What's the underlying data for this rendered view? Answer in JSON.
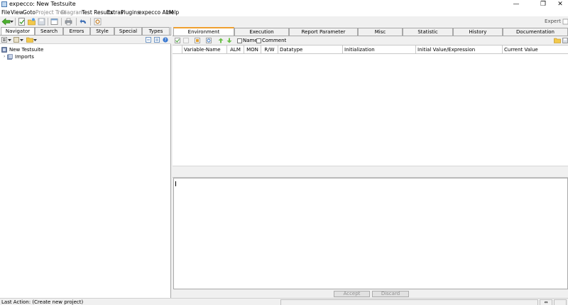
{
  "window": {
    "title": "expecco: New Testsuite",
    "minimize": "—",
    "restore": "❐",
    "close": "✕"
  },
  "menu": [
    {
      "label": "File",
      "enabled": true
    },
    {
      "label": "View",
      "enabled": true
    },
    {
      "label": "Goto",
      "enabled": true
    },
    {
      "label": "Project Tree",
      "enabled": false
    },
    {
      "label": "Diagram",
      "enabled": false
    },
    {
      "label": "Test Results",
      "enabled": true
    },
    {
      "label": "Extras",
      "enabled": true
    },
    {
      "label": "Plugins",
      "enabled": true
    },
    {
      "label": "expecco ALM",
      "enabled": true
    },
    {
      "label": "Help",
      "enabled": true
    }
  ],
  "toolbar": {
    "mode_label": "Expert"
  },
  "left": {
    "tabs": [
      "Navigator",
      "Search",
      "Errors",
      "Style",
      "Special",
      "Types"
    ],
    "active_tab": "Navigator",
    "tree": [
      {
        "label": "New Testsuite",
        "icon": "testsuite-icon"
      },
      {
        "label": "Imports",
        "icon": "imports-icon"
      }
    ]
  },
  "right": {
    "tabs": [
      "Environment",
      "Execution",
      "Report Parameter",
      "Misc",
      "Statistic",
      "History",
      "Documentation"
    ],
    "active_tab": "Environment",
    "filters": [
      {
        "label": "Name",
        "checked": false
      },
      {
        "label": "Comment",
        "checked": false
      }
    ],
    "columns": [
      "Variable-Name",
      "ALM",
      "MON",
      "R/W",
      "Datatype",
      "Initialization",
      "Initial Value/Expression",
      "Current Value"
    ],
    "accept_label": "Accept",
    "discard_label": "Discard"
  },
  "status": {
    "text": "Last Action:  (Create new project)",
    "cell_label": "⇔"
  },
  "colors": {
    "active_tab_accent": "#f0a030",
    "window_bg": "#f0f0f0"
  }
}
